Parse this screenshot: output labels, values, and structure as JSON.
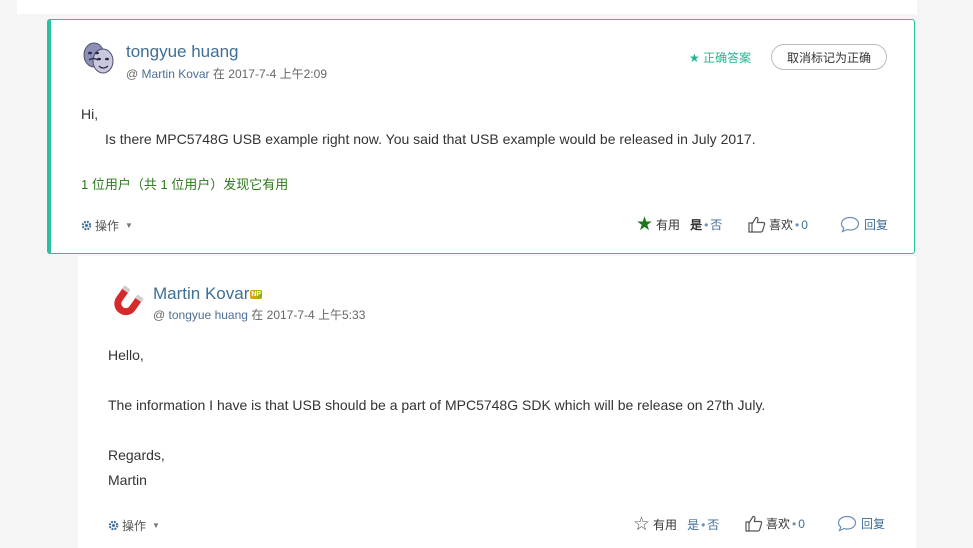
{
  "posts": [
    {
      "author": "tongyue huang",
      "at": "@",
      "reply_to": "Martin Kovar",
      "date_prefix": "在",
      "date": "2017-7-4 上午2:09",
      "correct_label": "正确答案",
      "unmark_label": "取消标记为正确",
      "body": [
        "Hi,",
        "Is there MPC5748G USB  example right now. You said that USB  example would  be released in July 2017."
      ],
      "helpful_text": "1 位用户（共 1 位用户）发现它有用",
      "actions_label": "操作",
      "useful_label": "有用",
      "yes_label": "是",
      "no_label": "否",
      "like_label": "喜欢",
      "like_count": "0",
      "reply_label": "回复",
      "accent": "#2cc0a3"
    },
    {
      "author": "Martin Kovar",
      "badge": "NP",
      "at": "@",
      "reply_to": "tongyue huang",
      "date_prefix": "在",
      "date": "2017-7-4 上午5:33",
      "body": [
        "Hello,",
        "The information I have is that USB should be a part of MPC5748G SDK which will be release on 27th July.",
        "Regards,",
        "Martin"
      ],
      "actions_label": "操作",
      "useful_label": "有用",
      "yes_label": "是",
      "no_label": "否",
      "like_label": "喜欢",
      "like_count": "0",
      "reply_label": "回复"
    }
  ]
}
